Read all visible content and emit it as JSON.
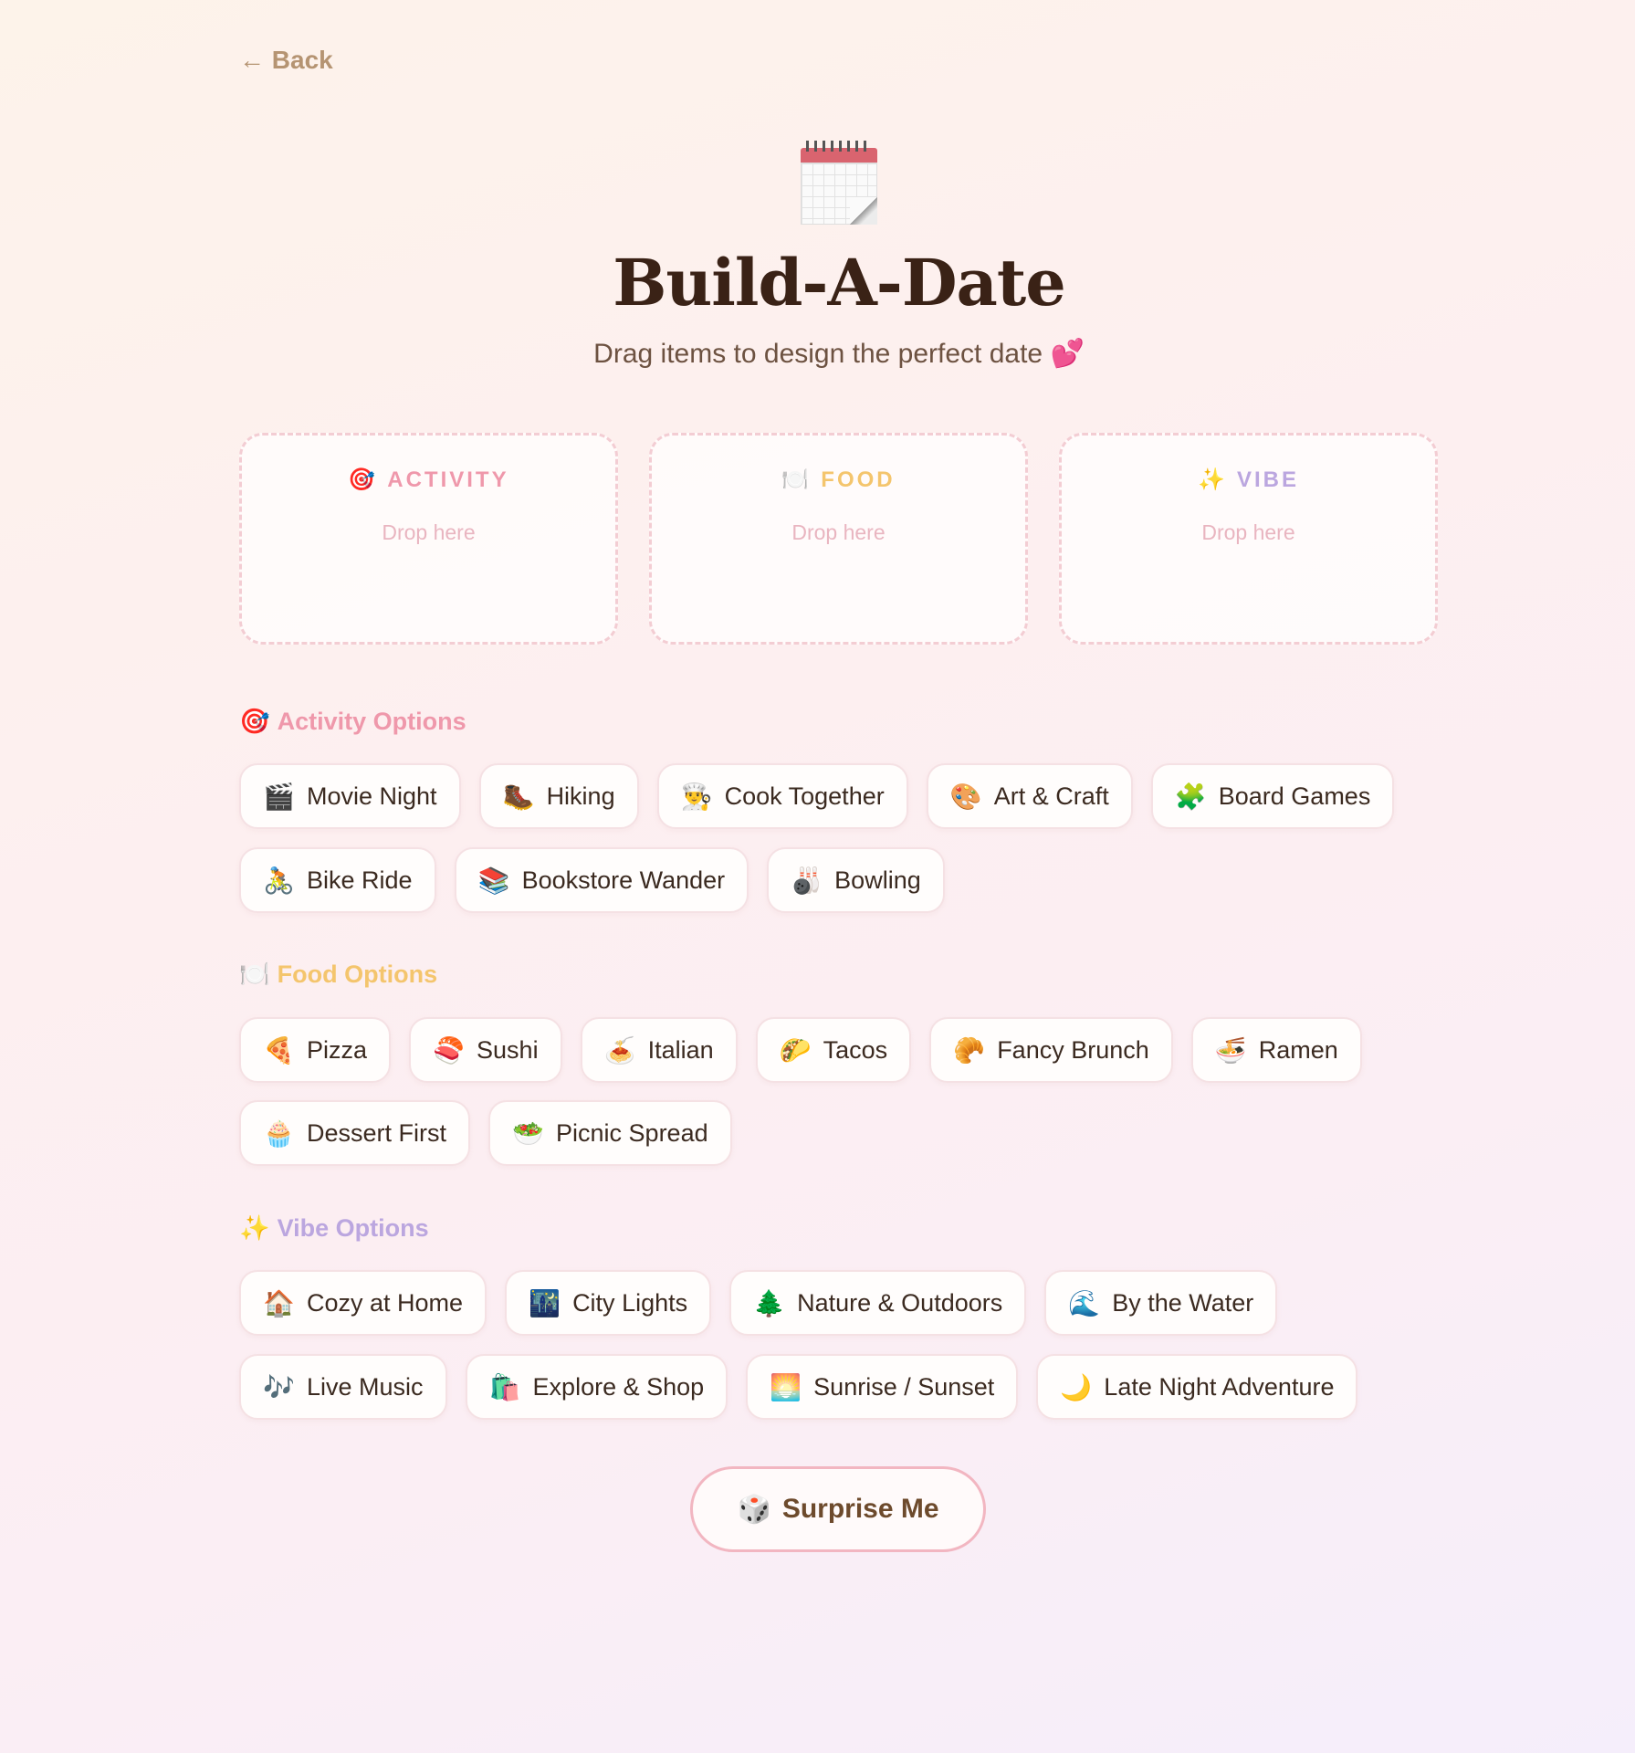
{
  "nav": {
    "back_label": "← Back"
  },
  "header": {
    "icon": "calendar-icon",
    "title": "Build-A-Date",
    "subtitle": "Drag items to design the perfect date 💕"
  },
  "colors": {
    "activity": "#ef98ab",
    "food": "#f4c56d",
    "vibe": "#bba6df",
    "title": "#3a2216"
  },
  "zones": [
    {
      "icon": "🎯",
      "label": "ACTIVITY",
      "placeholder": "Drop here"
    },
    {
      "icon": "🍽️",
      "label": "FOOD",
      "placeholder": "Drop here"
    },
    {
      "icon": "✨",
      "label": "VIBE",
      "placeholder": "Drop here"
    }
  ],
  "sections": {
    "activity": {
      "icon": "🎯",
      "title": "Activity Options",
      "items": [
        {
          "icon": "🎬",
          "label": "Movie Night"
        },
        {
          "icon": "🥾",
          "label": "Hiking"
        },
        {
          "icon": "👨‍🍳",
          "label": "Cook Together"
        },
        {
          "icon": "🎨",
          "label": "Art & Craft"
        },
        {
          "icon": "🧩",
          "label": "Board Games"
        },
        {
          "icon": "🚴",
          "label": "Bike Ride"
        },
        {
          "icon": "📚",
          "label": "Bookstore Wander"
        },
        {
          "icon": "🎳",
          "label": "Bowling"
        }
      ]
    },
    "food": {
      "icon": "🍽️",
      "title": "Food Options",
      "items": [
        {
          "icon": "🍕",
          "label": "Pizza"
        },
        {
          "icon": "🍣",
          "label": "Sushi"
        },
        {
          "icon": "🍝",
          "label": "Italian"
        },
        {
          "icon": "🌮",
          "label": "Tacos"
        },
        {
          "icon": "🥐",
          "label": "Fancy Brunch"
        },
        {
          "icon": "🍜",
          "label": "Ramen"
        },
        {
          "icon": "🧁",
          "label": "Dessert First"
        },
        {
          "icon": "🥗",
          "label": "Picnic Spread"
        }
      ]
    },
    "vibe": {
      "icon": "✨",
      "title": "Vibe Options",
      "items": [
        {
          "icon": "🏠",
          "label": "Cozy at Home"
        },
        {
          "icon": "🌃",
          "label": "City Lights"
        },
        {
          "icon": "🌲",
          "label": "Nature & Outdoors"
        },
        {
          "icon": "🌊",
          "label": "By the Water"
        },
        {
          "icon": "🎶",
          "label": "Live Music"
        },
        {
          "icon": "🛍️",
          "label": "Explore & Shop"
        },
        {
          "icon": "🌅",
          "label": "Sunrise / Sunset"
        },
        {
          "icon": "🌙",
          "label": "Late Night Adventure"
        }
      ]
    }
  },
  "surprise": {
    "icon": "🎲",
    "label": "Surprise Me"
  }
}
